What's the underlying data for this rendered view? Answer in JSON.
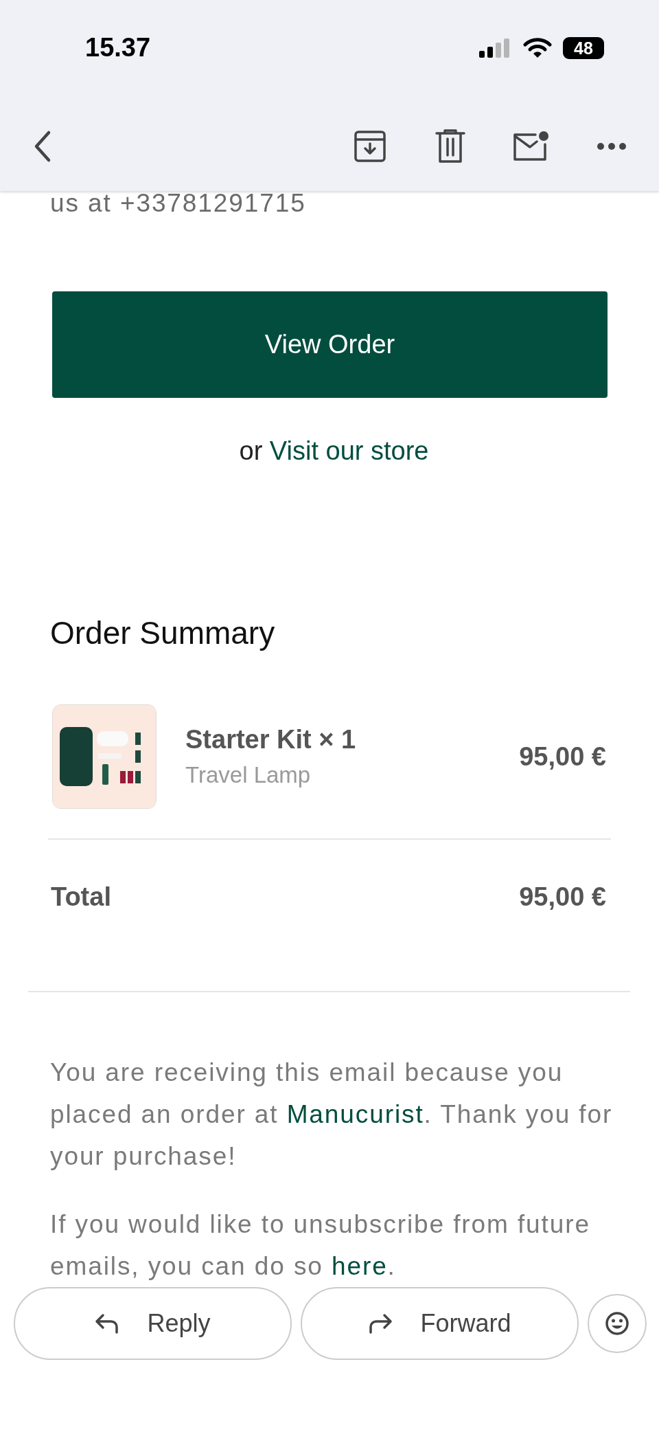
{
  "status_bar": {
    "time": "15.37",
    "battery": "48"
  },
  "email": {
    "intro": "us at +33781291715",
    "button": "View Order",
    "store_prefix": "or",
    "store_link": "Visit our store",
    "summary_title": "Order Summary",
    "items": [
      {
        "name": "Starter Kit × 1",
        "variant": "Travel Lamp",
        "price": "95,00 €"
      }
    ],
    "total_label": "Total",
    "total_value": "95,00 €",
    "footer": [
      {
        "segments": [
          {
            "text": "You are receiving this email because you placed an order at ",
            "link": false
          },
          {
            "text": "Manucurist",
            "link": true
          },
          {
            "text": ". Thank you for your purchase!",
            "link": false
          }
        ]
      },
      {
        "segments": [
          {
            "text": "If you would like to unsubscribe from future emails, you can do so ",
            "link": false
          },
          {
            "text": "here",
            "link": true
          },
          {
            "text": ".",
            "link": false
          }
        ]
      }
    ]
  },
  "actions": {
    "reply": "Reply",
    "forward": "Forward"
  }
}
